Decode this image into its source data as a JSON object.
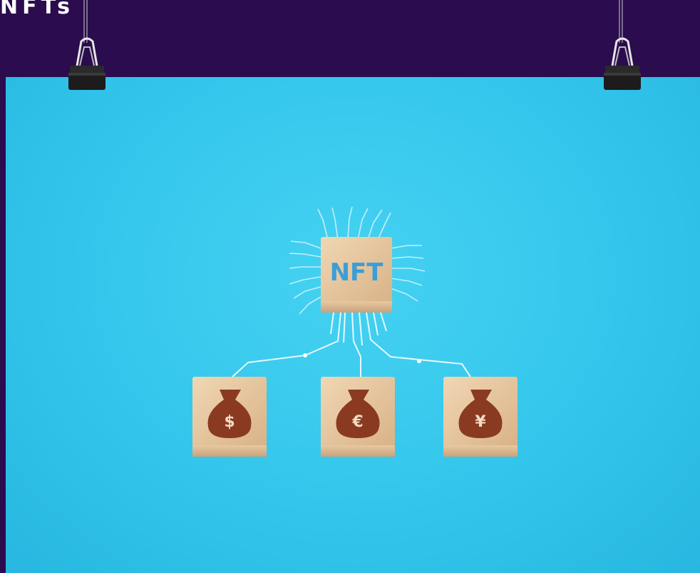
{
  "header": {
    "title": "NFTs"
  },
  "poster": {
    "main_block_label": "NFT",
    "blocks": [
      {
        "symbol": "$",
        "currency": "dollar"
      },
      {
        "symbol": "€",
        "currency": "euro"
      },
      {
        "symbol": "¥",
        "currency": "yen"
      }
    ]
  },
  "colors": {
    "background": "#2b0c4e",
    "poster": "#33c6ec",
    "wood": "#e8c9a2",
    "moneybag": "#8b3a22",
    "nft_text": "#3a9fd6"
  },
  "icons": [
    "binder-clip-icon",
    "circuit-lines-icon",
    "money-bag-icon"
  ]
}
